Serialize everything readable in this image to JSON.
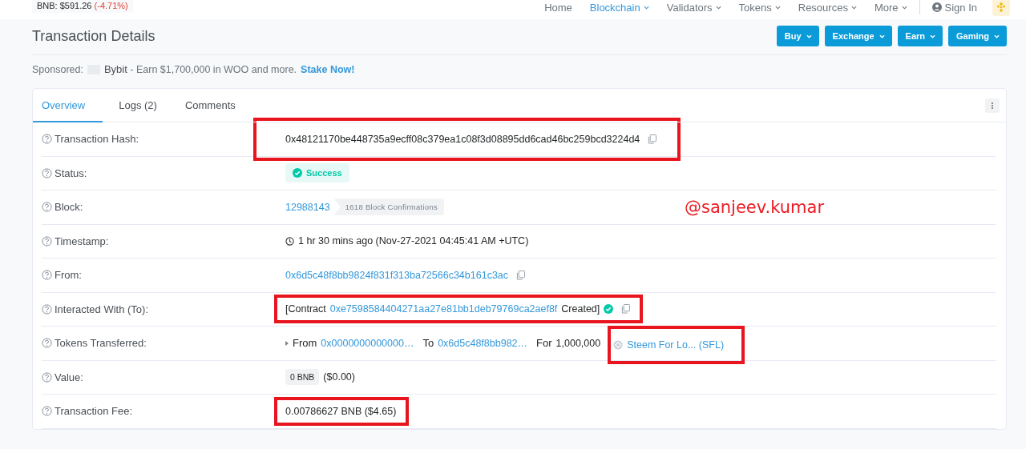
{
  "topbar": {
    "price_label": "BNB: $591.26",
    "price_change": "(-4.71%)",
    "nav": [
      {
        "label": "Home",
        "selected": false,
        "dropdown": false
      },
      {
        "label": "Blockchain",
        "selected": true,
        "dropdown": true
      },
      {
        "label": "Validators",
        "selected": false,
        "dropdown": true
      },
      {
        "label": "Tokens",
        "selected": false,
        "dropdown": true
      },
      {
        "label": "Resources",
        "selected": false,
        "dropdown": true
      },
      {
        "label": "More",
        "selected": false,
        "dropdown": true
      }
    ],
    "sign_in": "Sign In"
  },
  "page_title": "Transaction Details",
  "header_buttons": [
    "Buy",
    "Exchange",
    "Earn",
    "Gaming"
  ],
  "sponsored": {
    "label": "Sponsored:",
    "brand": "Bybit",
    "text": "- Earn $1,700,000 in WOO and more.",
    "link": "Stake Now!"
  },
  "tabs": [
    {
      "label": "Overview",
      "selected": true
    },
    {
      "label": "Logs (2)",
      "selected": false
    },
    {
      "label": "Comments",
      "selected": false
    }
  ],
  "annotation": "@sanjeev.kumar",
  "rows": [
    {
      "kind": "hash",
      "label": "Transaction Hash:",
      "value": "0x48121170be448735a9ecff08c379ea1c08f3d08895dd6cad46bc259bcd3224d4",
      "highlighted": true
    },
    {
      "kind": "status",
      "label": "Status:",
      "value": "Success"
    },
    {
      "kind": "block",
      "label": "Block:",
      "value": "12988143",
      "badge": "1618 Block Confirmations"
    },
    {
      "kind": "timestamp",
      "label": "Timestamp:",
      "value": "1 hr 30 mins ago (Nov-27-2021 04:45:41 AM +UTC)"
    },
    {
      "kind": "address",
      "label": "From:",
      "value": "0x6d5c48f8bb9824f831f313ba72566c34b161c3ac"
    },
    {
      "kind": "contract",
      "label": "Interacted With (To):",
      "prefix": "[Contract",
      "value": "0xe7598584404271aa27e81bb1deb79769ca2aef8f",
      "suffix": "Created]",
      "highlighted": true
    },
    {
      "kind": "tokens",
      "label": "Tokens Transferred:",
      "from_label": "From",
      "from": "0x0000000000000…",
      "to_label": "To",
      "to": "0x6d5c48f8bb982…",
      "for_label": "For",
      "amount": "1,000,000",
      "token": "Steem For Lo... (SFL)",
      "token_highlighted": true
    },
    {
      "kind": "value",
      "label": "Value:",
      "badge": "0 BNB",
      "value": "($0.00)"
    },
    {
      "kind": "fee",
      "label": "Transaction Fee:",
      "value": "0.00786627 BNB ($4.65)",
      "highlighted": true
    }
  ]
}
